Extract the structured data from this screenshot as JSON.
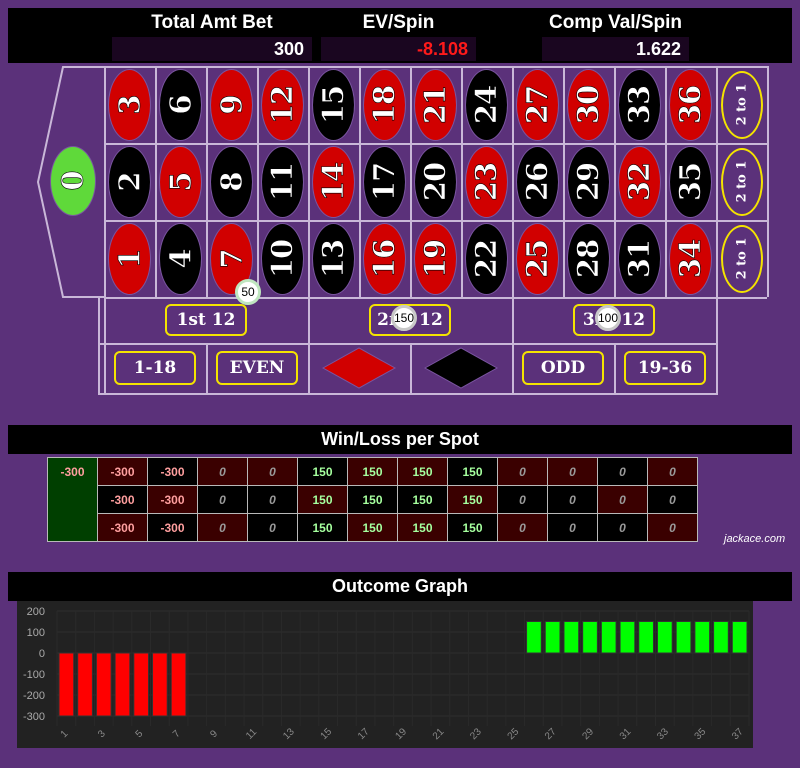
{
  "header": {
    "total_amt_bet": {
      "label": "Total Amt Bet",
      "value": "300"
    },
    "ev_spin": {
      "label": "EV/Spin",
      "value": "-8.108"
    },
    "comp_val_spin": {
      "label": "Comp Val/Spin",
      "value": "1.622"
    }
  },
  "table": {
    "zero": {
      "label": "0",
      "color": "green"
    },
    "rows": [
      [
        {
          "n": "3",
          "c": "red"
        },
        {
          "n": "6",
          "c": "black"
        },
        {
          "n": "9",
          "c": "red"
        },
        {
          "n": "12",
          "c": "red"
        },
        {
          "n": "15",
          "c": "black"
        },
        {
          "n": "18",
          "c": "red"
        },
        {
          "n": "21",
          "c": "red"
        },
        {
          "n": "24",
          "c": "black"
        },
        {
          "n": "27",
          "c": "red"
        },
        {
          "n": "30",
          "c": "red"
        },
        {
          "n": "33",
          "c": "black"
        },
        {
          "n": "36",
          "c": "red"
        }
      ],
      [
        {
          "n": "2",
          "c": "black"
        },
        {
          "n": "5",
          "c": "red"
        },
        {
          "n": "8",
          "c": "black"
        },
        {
          "n": "11",
          "c": "black"
        },
        {
          "n": "14",
          "c": "red"
        },
        {
          "n": "17",
          "c": "black"
        },
        {
          "n": "20",
          "c": "black"
        },
        {
          "n": "23",
          "c": "red"
        },
        {
          "n": "26",
          "c": "black"
        },
        {
          "n": "29",
          "c": "black"
        },
        {
          "n": "32",
          "c": "red"
        },
        {
          "n": "35",
          "c": "black"
        }
      ],
      [
        {
          "n": "1",
          "c": "red"
        },
        {
          "n": "4",
          "c": "black"
        },
        {
          "n": "7",
          "c": "red"
        },
        {
          "n": "10",
          "c": "black"
        },
        {
          "n": "13",
          "c": "black"
        },
        {
          "n": "16",
          "c": "red"
        },
        {
          "n": "19",
          "c": "red"
        },
        {
          "n": "22",
          "c": "black"
        },
        {
          "n": "25",
          "c": "red"
        },
        {
          "n": "28",
          "c": "black"
        },
        {
          "n": "31",
          "c": "black"
        },
        {
          "n": "34",
          "c": "red"
        }
      ]
    ],
    "column_bets": [
      "2 to 1",
      "2 to 1",
      "2 to 1"
    ],
    "dozens": [
      "1st 12",
      "2nd 12",
      "3rd 12"
    ],
    "outside": [
      "1-18",
      "EVEN",
      "red-diamond",
      "black-diamond",
      "ODD",
      "19-36"
    ],
    "chips": [
      {
        "spot": "corner 7/8/10/11 split",
        "amount": "50"
      },
      {
        "spot": "2nd 12",
        "amount": "150"
      },
      {
        "spot": "3rd 12",
        "amount": "100"
      }
    ],
    "colors": {
      "felt": "#5b317a",
      "red": "#d10000",
      "black": "#000000",
      "green": "#5fd93a",
      "label_border": "#f4e300"
    }
  },
  "winloss": {
    "title": "Win/Loss per Spot",
    "zero_value": "-300",
    "rows": [
      [
        "-300",
        "-300",
        "0",
        "0",
        "150",
        "150",
        "150",
        "150",
        "0",
        "0",
        "0",
        "0"
      ],
      [
        "-300",
        "-300",
        "0",
        "0",
        "150",
        "150",
        "150",
        "150",
        "0",
        "0",
        "0",
        "0"
      ],
      [
        "-300",
        "-300",
        "0",
        "0",
        "150",
        "150",
        "150",
        "150",
        "0",
        "0",
        "0",
        "0"
      ]
    ],
    "brand": "jackace.com"
  },
  "chart_data": {
    "type": "bar",
    "title": "Outcome Graph",
    "xlabel": "",
    "ylabel": "",
    "categories": [
      "1",
      "2",
      "3",
      "4",
      "5",
      "6",
      "7",
      "8",
      "9",
      "10",
      "11",
      "12",
      "13",
      "14",
      "15",
      "16",
      "17",
      "18",
      "19",
      "20",
      "21",
      "22",
      "23",
      "24",
      "25",
      "26",
      "27",
      "28",
      "29",
      "30",
      "31",
      "32",
      "33",
      "34",
      "35",
      "36",
      "37"
    ],
    "x_tick_labels": [
      "1",
      "3",
      "5",
      "7",
      "9",
      "11",
      "13",
      "15",
      "17",
      "19",
      "21",
      "23",
      "25",
      "27",
      "29",
      "31",
      "33",
      "35",
      "37"
    ],
    "values": [
      -300,
      -300,
      -300,
      -300,
      -300,
      -300,
      -300,
      0,
      0,
      0,
      0,
      0,
      0,
      0,
      0,
      0,
      0,
      0,
      0,
      0,
      0,
      0,
      0,
      0,
      0,
      150,
      150,
      150,
      150,
      150,
      150,
      150,
      150,
      150,
      150,
      150,
      150
    ],
    "ylim": [
      -300,
      200
    ],
    "y_ticks": [
      200,
      100,
      0,
      -100,
      -200,
      -300
    ],
    "grid": true,
    "colors": {
      "negative": "#ff0000",
      "positive": "#00ff00",
      "background": "#222222"
    }
  }
}
